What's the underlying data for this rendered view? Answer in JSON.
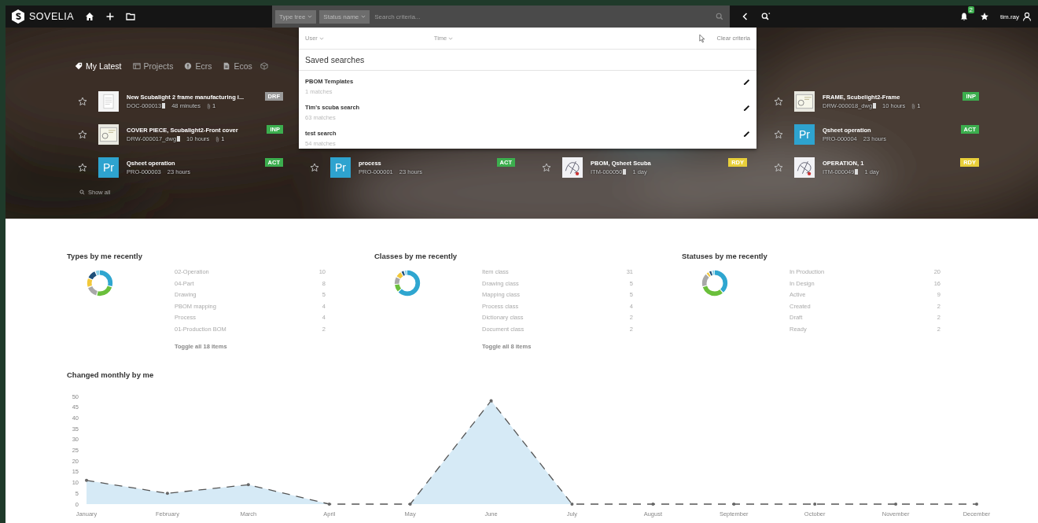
{
  "top_bar": {
    "brand": "SOVELIA",
    "type_filter": "Type tree",
    "status_filter": "Status name",
    "search": {
      "placeholder": "Search criteria..."
    },
    "notifications": "2",
    "user": "tim.ray"
  },
  "search_dropdown": {
    "user_filter": "User",
    "time_filter": "Time",
    "clear": "Clear criteria",
    "heading": "Saved searches",
    "saved": [
      {
        "name": "PBOM Templates",
        "matches": "1 matches"
      },
      {
        "name": "Tim's scuba search",
        "matches": "63 matches"
      },
      {
        "name": "test search",
        "matches": "54 matches"
      }
    ]
  },
  "tabs": [
    {
      "label": "My Latest",
      "selected": true
    },
    {
      "label": "Projects",
      "selected": false
    },
    {
      "label": "Ecrs",
      "selected": false
    },
    {
      "label": "Ecos",
      "selected": false
    }
  ],
  "latest_columns": [
    [
      {
        "title": "New Scubalight 2 frame manufacturing i...",
        "code": "DOC-000013",
        "flagged": true,
        "age": "48 minutes",
        "attachments": "1",
        "status": "DRF",
        "color": "#9a9a9a",
        "thumb": {
          "kind": "document"
        }
      },
      {
        "title": "COVER PIECE, Scubalight2-Front cover",
        "code": "DRW-000017_dwg",
        "flagged": true,
        "age": "10 hours",
        "attachments": "1",
        "status": "INP",
        "color": "#3cae4e",
        "thumb": {
          "kind": "drawing"
        }
      },
      {
        "title": "Qsheet operation",
        "code": "PRO-000003",
        "flagged": false,
        "age": "23 hours",
        "status": "ACT",
        "color": "#3cae4e",
        "thumb": {
          "kind": "text",
          "label": "Pr"
        }
      }
    ],
    [
      {
        "title": "process",
        "code": "PRO-000001",
        "flagged": false,
        "age": "23 hours",
        "status": "ACT",
        "color": "#3cae4e",
        "thumb": {
          "kind": "text",
          "label": "Pr"
        }
      }
    ],
    [
      {
        "title": "PBOM, Qsheet Scuba",
        "code": "ITM-000050",
        "flagged": true,
        "age": "1 day",
        "status": "RDY",
        "color": "#e8cf3a",
        "thumb": {
          "kind": "sketch"
        }
      }
    ],
    [
      {
        "title": "FRAME, Scubelight2-Frame",
        "code": "DRW-000018_dwg",
        "flagged": true,
        "age": "10 hours",
        "attachments": "1",
        "status": "INP",
        "color": "#3cae4e",
        "thumb": {
          "kind": "drawing"
        }
      },
      {
        "title": "Qsheet operation",
        "code": "PRO-000004",
        "flagged": false,
        "age": "23 hours",
        "status": "ACT",
        "color": "#3cae4e",
        "thumb": {
          "kind": "text",
          "label": "Pr"
        }
      },
      {
        "title": "OPERATION, 1",
        "code": "ITM-000049",
        "flagged": true,
        "age": "1 day",
        "status": "RDY",
        "color": "#e8cf3a",
        "thumb": {
          "kind": "sketch"
        }
      }
    ]
  ],
  "show_all": "Show all",
  "summaries": [
    {
      "title": "Types by me recently",
      "items": [
        {
          "label": "02-Operation",
          "value": "10"
        },
        {
          "label": "04-Part",
          "value": "8"
        },
        {
          "label": "Drawing",
          "value": "5"
        },
        {
          "label": "PBOM mapping",
          "value": "4"
        },
        {
          "label": "Process",
          "value": "4"
        },
        {
          "label": "01-Production BOM",
          "value": "2"
        }
      ],
      "toggle": "Toggle all 18 items"
    },
    {
      "title": "Classes by me recently",
      "items": [
        {
          "label": "Item class",
          "value": "31"
        },
        {
          "label": "Drawing class",
          "value": "5"
        },
        {
          "label": "Mapping class",
          "value": "5"
        },
        {
          "label": "Process class",
          "value": "4"
        },
        {
          "label": "Dictionary class",
          "value": "2"
        },
        {
          "label": "Document class",
          "value": "2"
        }
      ],
      "toggle": "Toggle all 8 items"
    },
    {
      "title": "Statuses by me recently",
      "items": [
        {
          "label": "In Production",
          "value": "20"
        },
        {
          "label": "In Design",
          "value": "16"
        },
        {
          "label": "Active",
          "value": "9"
        },
        {
          "label": "Created",
          "value": "2"
        },
        {
          "label": "Draft",
          "value": "2"
        },
        {
          "label": "Ready",
          "value": "2"
        }
      ]
    }
  ],
  "monthly": {
    "title": "Changed monthly by me",
    "chart_data": {
      "type": "area",
      "categories": [
        "January",
        "February",
        "March",
        "April",
        "May",
        "June",
        "July",
        "August",
        "September",
        "October",
        "November",
        "December"
      ],
      "series": [
        {
          "color": "#d6eaf6",
          "values": [
            11,
            5,
            9,
            0,
            0,
            48,
            0,
            0,
            0,
            0,
            0,
            0
          ]
        }
      ],
      "ylim": [
        0,
        50
      ],
      "yticks": [
        0,
        5,
        10,
        15,
        20,
        25,
        30,
        35,
        40,
        45,
        50
      ]
    }
  }
}
